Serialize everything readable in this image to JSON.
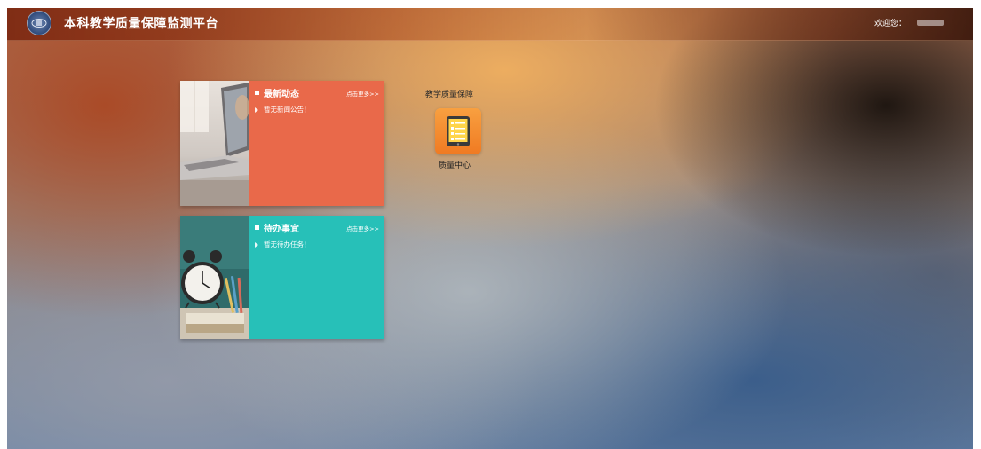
{
  "header": {
    "title": "本科教学质量保障监测平台",
    "welcome_label": "欢迎您："
  },
  "cards": {
    "news": {
      "title": "最新动态",
      "more_label": "点击更多>>",
      "empty_text": "暂无新闻公告！",
      "color": "#e9694a"
    },
    "todo": {
      "title": "待办事宜",
      "more_label": "点击更多>>",
      "empty_text": "暂无待办任务！",
      "color": "#27c0b8"
    }
  },
  "shortcuts": {
    "section_label": "教学质量保障",
    "tile": {
      "label": "质量中心",
      "icon": "tablet-checklist-icon",
      "color": "#f07a22"
    }
  }
}
